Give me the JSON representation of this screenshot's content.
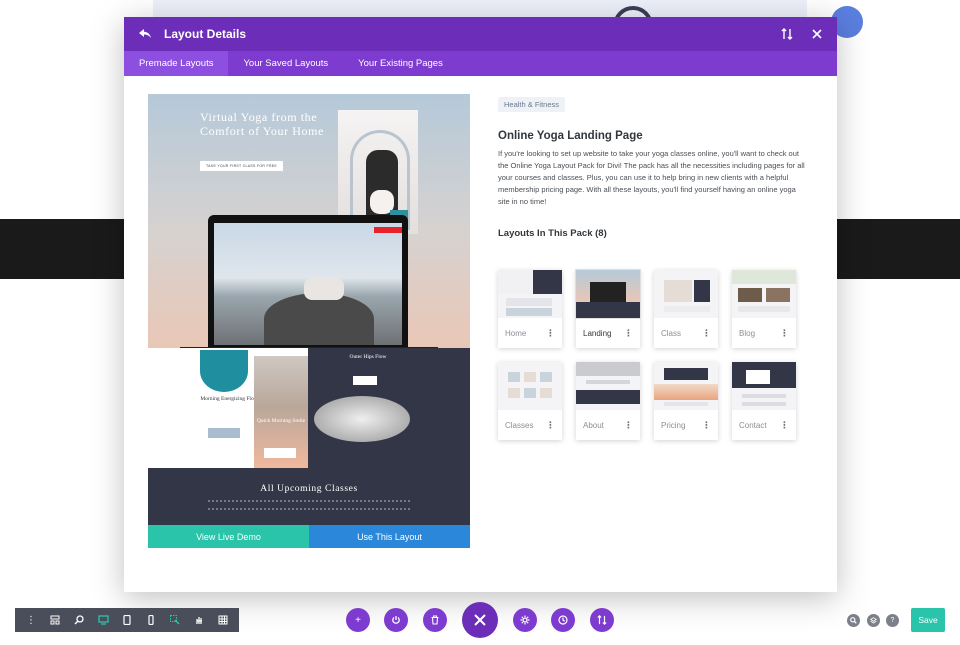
{
  "modal": {
    "title": "Layout Details",
    "tabs": [
      {
        "label": "Premade Layouts",
        "active": true
      },
      {
        "label": "Your Saved Layouts",
        "active": false
      },
      {
        "label": "Your Existing Pages",
        "active": false
      }
    ],
    "header_icons": [
      "sort-icon",
      "close-icon"
    ]
  },
  "preview": {
    "headline": "Virtual Yoga from the Comfort of Your Home",
    "cta_label": "TAKE YOUR FIRST CLASS FOR FREE",
    "mid_left_title": "Morning Energizing Flow",
    "mid_center_title": "Quick Morning Smile",
    "mid_right_title": "Outer Hips Flow",
    "bottom_title": "All Upcoming Classes",
    "live_demo_label": "View Live Demo",
    "use_layout_label": "Use This Layout"
  },
  "pack": {
    "category": "Health & Fitness",
    "title": "Online Yoga Landing Page",
    "description": "If you're looking to set up website to take your yoga classes online, you'll want to check out the Online Yoga Layout Pack for Divi! The pack has all the necessities including pages for all your courses and classes. Plus, you can use it to help bring in new clients with a helpful membership pricing page. With all these layouts, you'll find yourself having an online yoga site in no time!",
    "layouts_heading": "Layouts In This Pack (8)",
    "layouts": [
      {
        "label": "Home",
        "active": false
      },
      {
        "label": "Landing",
        "active": true
      },
      {
        "label": "Class",
        "active": false
      },
      {
        "label": "Blog",
        "active": false
      },
      {
        "label": "Classes",
        "active": false
      },
      {
        "label": "About",
        "active": false
      },
      {
        "label": "Pricing",
        "active": false
      },
      {
        "label": "Contact",
        "active": false
      }
    ]
  },
  "toolbar": {
    "left_group": [
      "more-icon",
      "wireframe-icon",
      "zoom-icon",
      "desktop-icon",
      "tablet-icon",
      "phone-icon"
    ],
    "right_group": [
      "click-mode-icon",
      "grab-mode-icon",
      "grid-icon"
    ],
    "center_buttons": [
      "add-icon",
      "power-icon",
      "trash-icon",
      "close-icon",
      "settings-icon",
      "history-icon",
      "sort-icon"
    ],
    "right_buttons": [
      "search-icon",
      "layers-icon",
      "help-icon"
    ],
    "save_label": "Save",
    "help_glyph": "?"
  },
  "colors": {
    "primary": "#6c2eb9",
    "tab_bar": "#7d3bd0",
    "teal": "#29c4a9",
    "blue": "#2b87da",
    "toolbar": "#4a4d5a"
  }
}
